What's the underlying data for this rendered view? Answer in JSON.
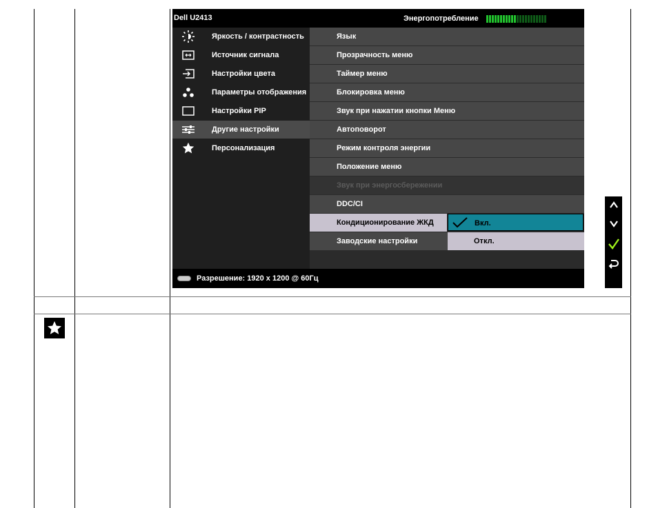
{
  "osd": {
    "model": "Dell U2413",
    "energy_label": "Энергопотребление",
    "energy_level": 0.5,
    "energy_segments": 22,
    "colors": {
      "energy_on": "#22c22e",
      "energy_off": "#0f5a18",
      "selected_option": "#128597",
      "check": "#9ef01a"
    }
  },
  "menu": {
    "items": [
      {
        "label": "Яркость / контрастность",
        "icon": "brightness-icon",
        "active": false
      },
      {
        "label": "Источник сигнала",
        "icon": "input-source-icon",
        "active": false
      },
      {
        "label": "Настройки цвета",
        "icon": "color-settings-icon",
        "active": false
      },
      {
        "label": "Параметры отображения",
        "icon": "display-settings-icon",
        "active": false
      },
      {
        "label": "Настройки PIP",
        "icon": "pip-icon",
        "active": false
      },
      {
        "label": "Другие настройки",
        "icon": "other-settings-icon",
        "active": true
      },
      {
        "label": "Персонализация",
        "icon": "star-icon",
        "active": false
      }
    ]
  },
  "submenu": {
    "items": [
      {
        "label": "Язык",
        "state": "normal"
      },
      {
        "label": "Прозрачность меню",
        "state": "normal"
      },
      {
        "label": "Таймер меню",
        "state": "normal"
      },
      {
        "label": "Блокировка меню",
        "state": "normal"
      },
      {
        "label": "Звук при нажатии кнопки Меню",
        "state": "normal"
      },
      {
        "label": "Автоповорот",
        "state": "normal"
      },
      {
        "label": "Режим контроля энергии",
        "state": "normal"
      },
      {
        "label": "Положение меню",
        "state": "normal"
      },
      {
        "label": "Звук при энергосбережении",
        "state": "disabled"
      },
      {
        "label": "DDC/CI",
        "state": "normal"
      },
      {
        "label": "Кондиционирование ЖКД",
        "state": "selected"
      },
      {
        "label": "Заводские настройки",
        "state": "normal"
      }
    ],
    "options": {
      "on": "Вкл.",
      "off": "Откл."
    }
  },
  "footer": {
    "resolution": "Разрешение: 1920 x 1200 @ 60Гц"
  },
  "nav": [
    "up-arrow-icon",
    "down-arrow-icon",
    "check-icon",
    "back-icon"
  ],
  "page": {
    "section_icon": "star-icon"
  }
}
